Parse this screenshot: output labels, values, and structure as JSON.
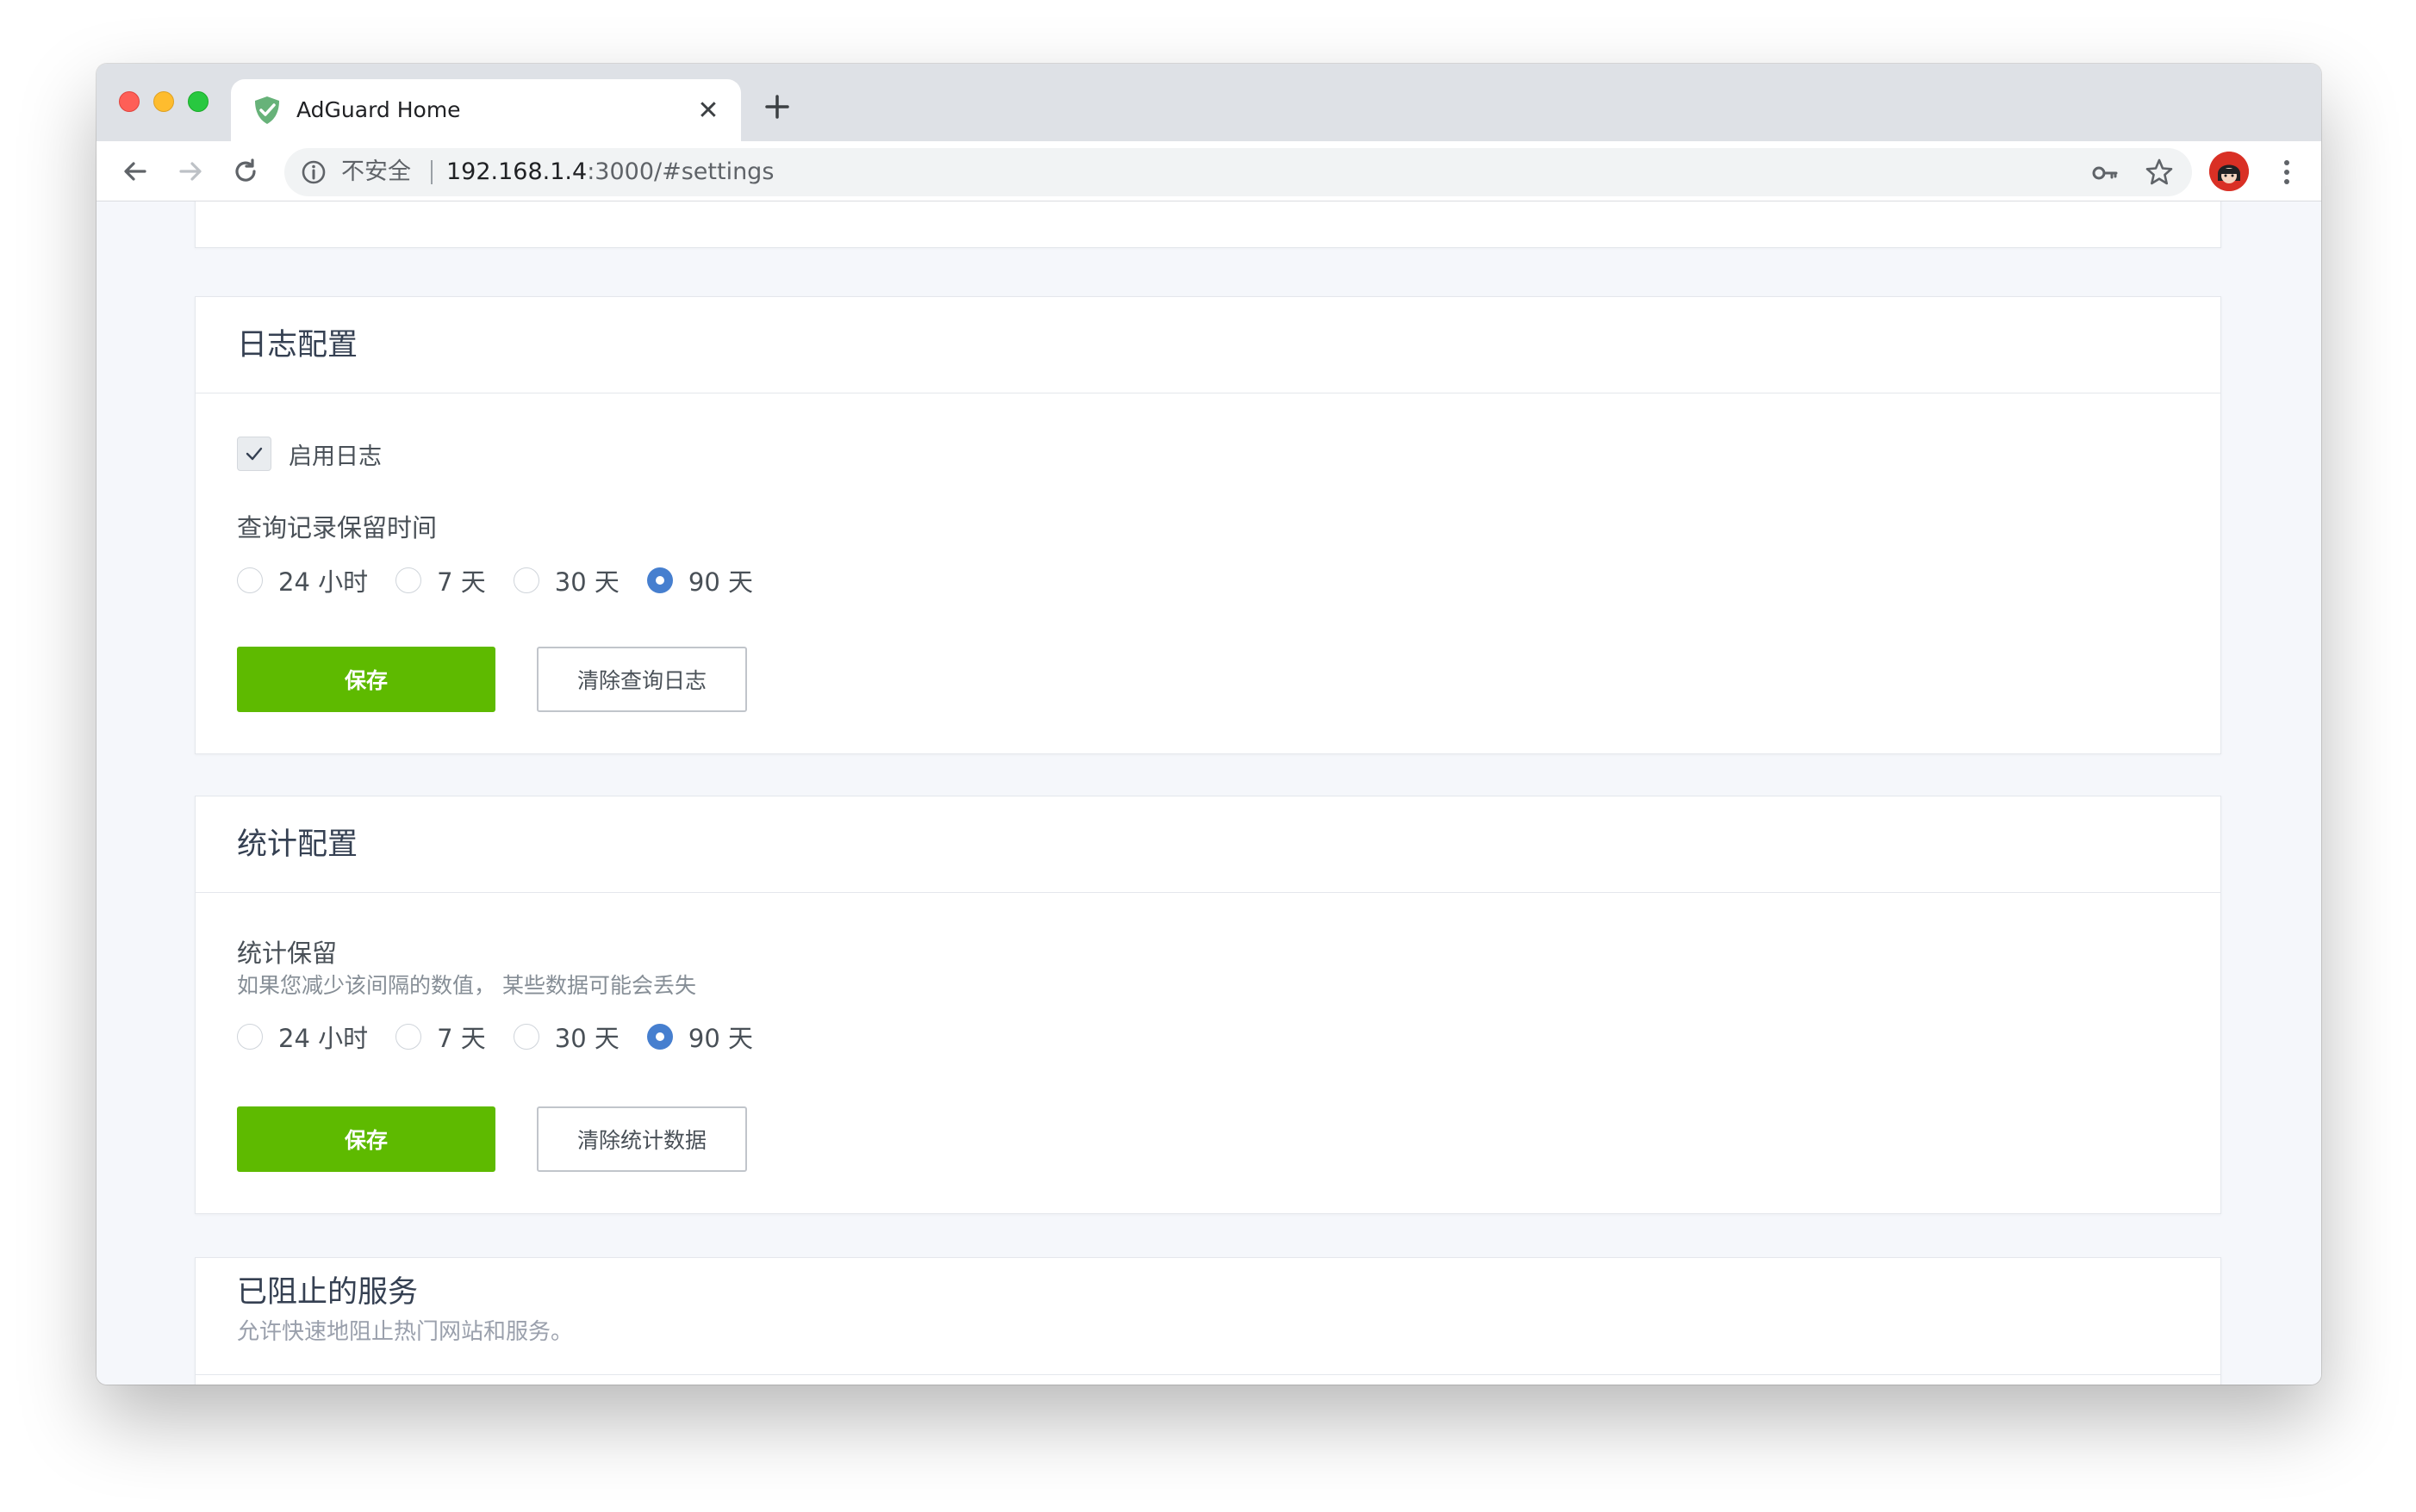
{
  "browser": {
    "tab_title": "AdGuard Home",
    "tab_close": "✕",
    "insecure_label": "不安全",
    "url_host": "192.168.1.4",
    "url_rest": ":3000/#settings"
  },
  "query_log": {
    "title": "日志配置",
    "enable_label": "启用日志",
    "retention_label": "查询记录保留时间",
    "options": [
      "24 小时",
      "7 天",
      "30 天",
      "90 天"
    ],
    "selected": "90 天",
    "save_label": "保存",
    "clear_label": "清除查询日志"
  },
  "stats": {
    "title": "统计配置",
    "retention_label": "统计保留",
    "hint": "如果您减少该间隔的数值， 某些数据可能会丢失",
    "options": [
      "24 小时",
      "7 天",
      "30 天",
      "90 天"
    ],
    "selected": "90 天",
    "save_label": "保存",
    "clear_label": "清除统计数据"
  },
  "blocked_services": {
    "title": "已阻止的服务",
    "subtitle": "允许快速地阻止热门网站和服务。"
  },
  "colors": {
    "save_green": "#5eba00",
    "radio_blue": "#467fcf",
    "favicon_green": "#67b279"
  },
  "icons": {
    "favicon": "adguard-shield-icon",
    "back": "arrow-left-icon",
    "forward": "arrow-right-icon",
    "reload": "reload-icon",
    "info": "info-icon",
    "key": "key-icon",
    "star": "star-icon",
    "menu": "kebab-menu-icon",
    "check": "check-icon"
  }
}
